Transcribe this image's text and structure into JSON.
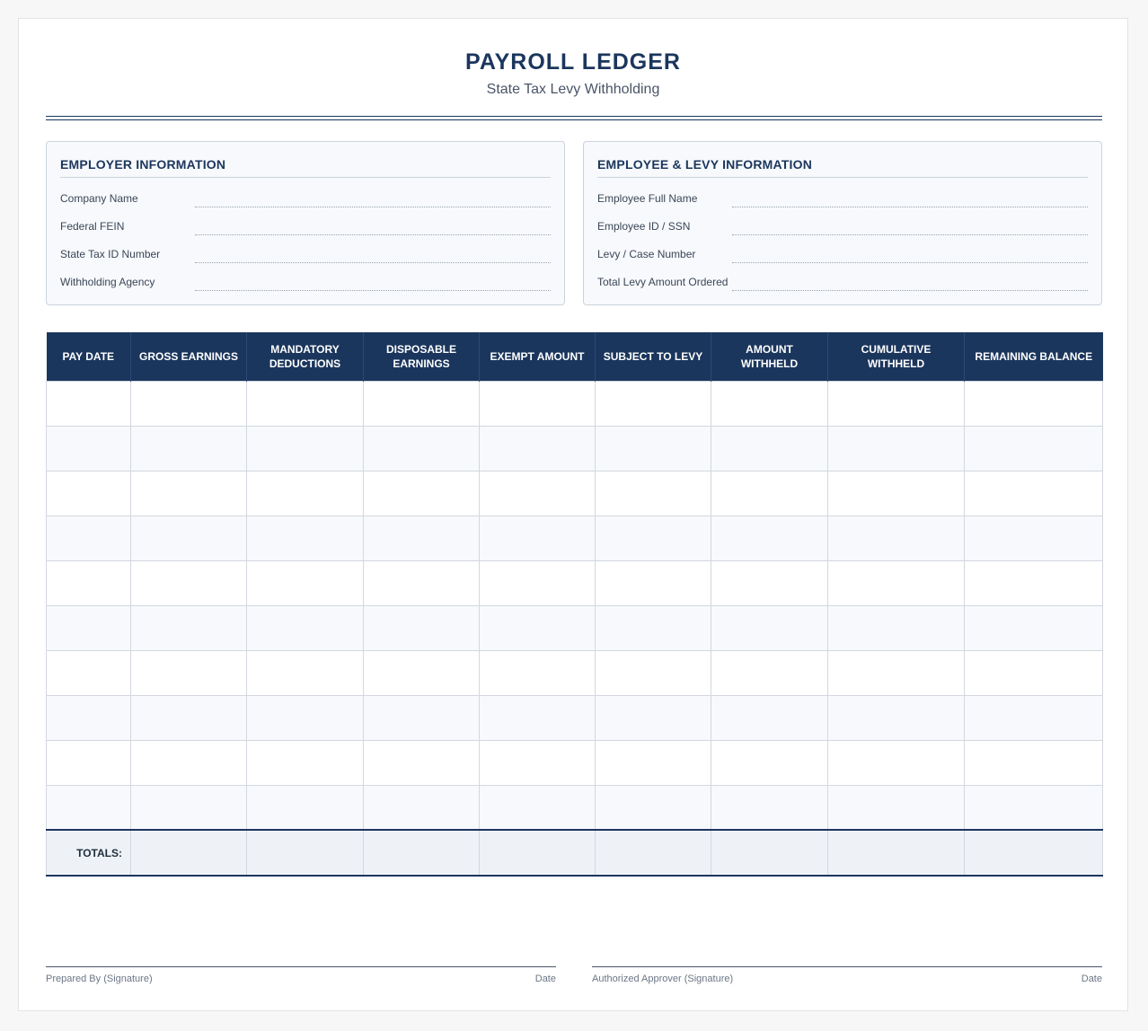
{
  "header": {
    "title": "PAYROLL LEDGER",
    "subtitle": "State Tax Levy Withholding"
  },
  "employer": {
    "heading": "EMPLOYER INFORMATION",
    "fields": [
      "Company Name",
      "Federal FEIN",
      "State Tax ID Number",
      "Withholding Agency"
    ]
  },
  "employee": {
    "heading": "EMPLOYEE & LEVY INFORMATION",
    "fields": [
      "Employee Full Name",
      "Employee ID / SSN",
      "Levy / Case Number",
      "Total Levy Amount Ordered"
    ]
  },
  "ledger": {
    "columns": [
      "PAY DATE",
      "GROSS EARNINGS",
      "MANDATORY DEDUCTIONS",
      "DISPOSABLE EARNINGS",
      "EXEMPT AMOUNT",
      "SUBJECT TO LEVY",
      "AMOUNT WITHHELD",
      "CUMULATIVE WITHHELD",
      "REMAINING BALANCE"
    ],
    "totals_label": "TOTALS:"
  },
  "signatures": {
    "prepared_by": "Prepared By (Signature)",
    "approver": "Authorized Approver (Signature)",
    "date_label": "Date"
  }
}
